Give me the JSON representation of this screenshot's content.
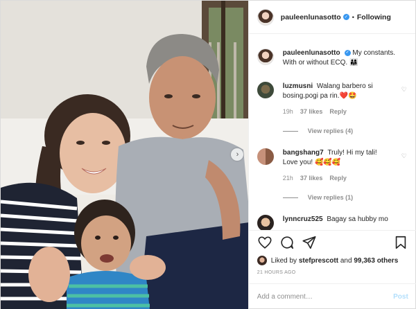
{
  "header": {
    "username": "pauleenlunasotto",
    "separator": "•",
    "follow_state": "Following"
  },
  "caption": {
    "username": "pauleenlunasotto",
    "text": "My constants. With or without ECQ.",
    "emoji": "👨‍👩‍👧"
  },
  "comments": [
    {
      "username": "luzmusni",
      "text": "Walang barbero si bosing.pogi pa rin.",
      "emoji": "❤️🤩",
      "time": "19h",
      "likes": "37 likes",
      "reply_label": "Reply",
      "view_replies": "View replies (4)"
    },
    {
      "username": "bangshang7",
      "text": "Truly! Hi my tali! Love you!",
      "emoji": "🥰🥰🥰",
      "time": "21h",
      "likes": "37 likes",
      "reply_label": "Reply",
      "view_replies": "View replies (1)"
    },
    {
      "username": "lynncruz525",
      "text": "Bagay sa hubby mo"
    }
  ],
  "liked_by": {
    "prefix": "Liked by",
    "user": "stefprescott",
    "middle": "and",
    "count": "99,363 others"
  },
  "timestamp": "21 HOURS AGO",
  "add_comment": {
    "placeholder": "Add a comment…",
    "post_label": "Post"
  },
  "colors": {
    "verified": "#3897f0",
    "muted": "#8e8e8e",
    "post_disabled": "#b2dffc",
    "heart_red": "#ed4956"
  },
  "icons": [
    "verified-badge-icon",
    "heart-icon",
    "comment-icon",
    "share-icon",
    "save-icon",
    "chevron-right-icon"
  ]
}
